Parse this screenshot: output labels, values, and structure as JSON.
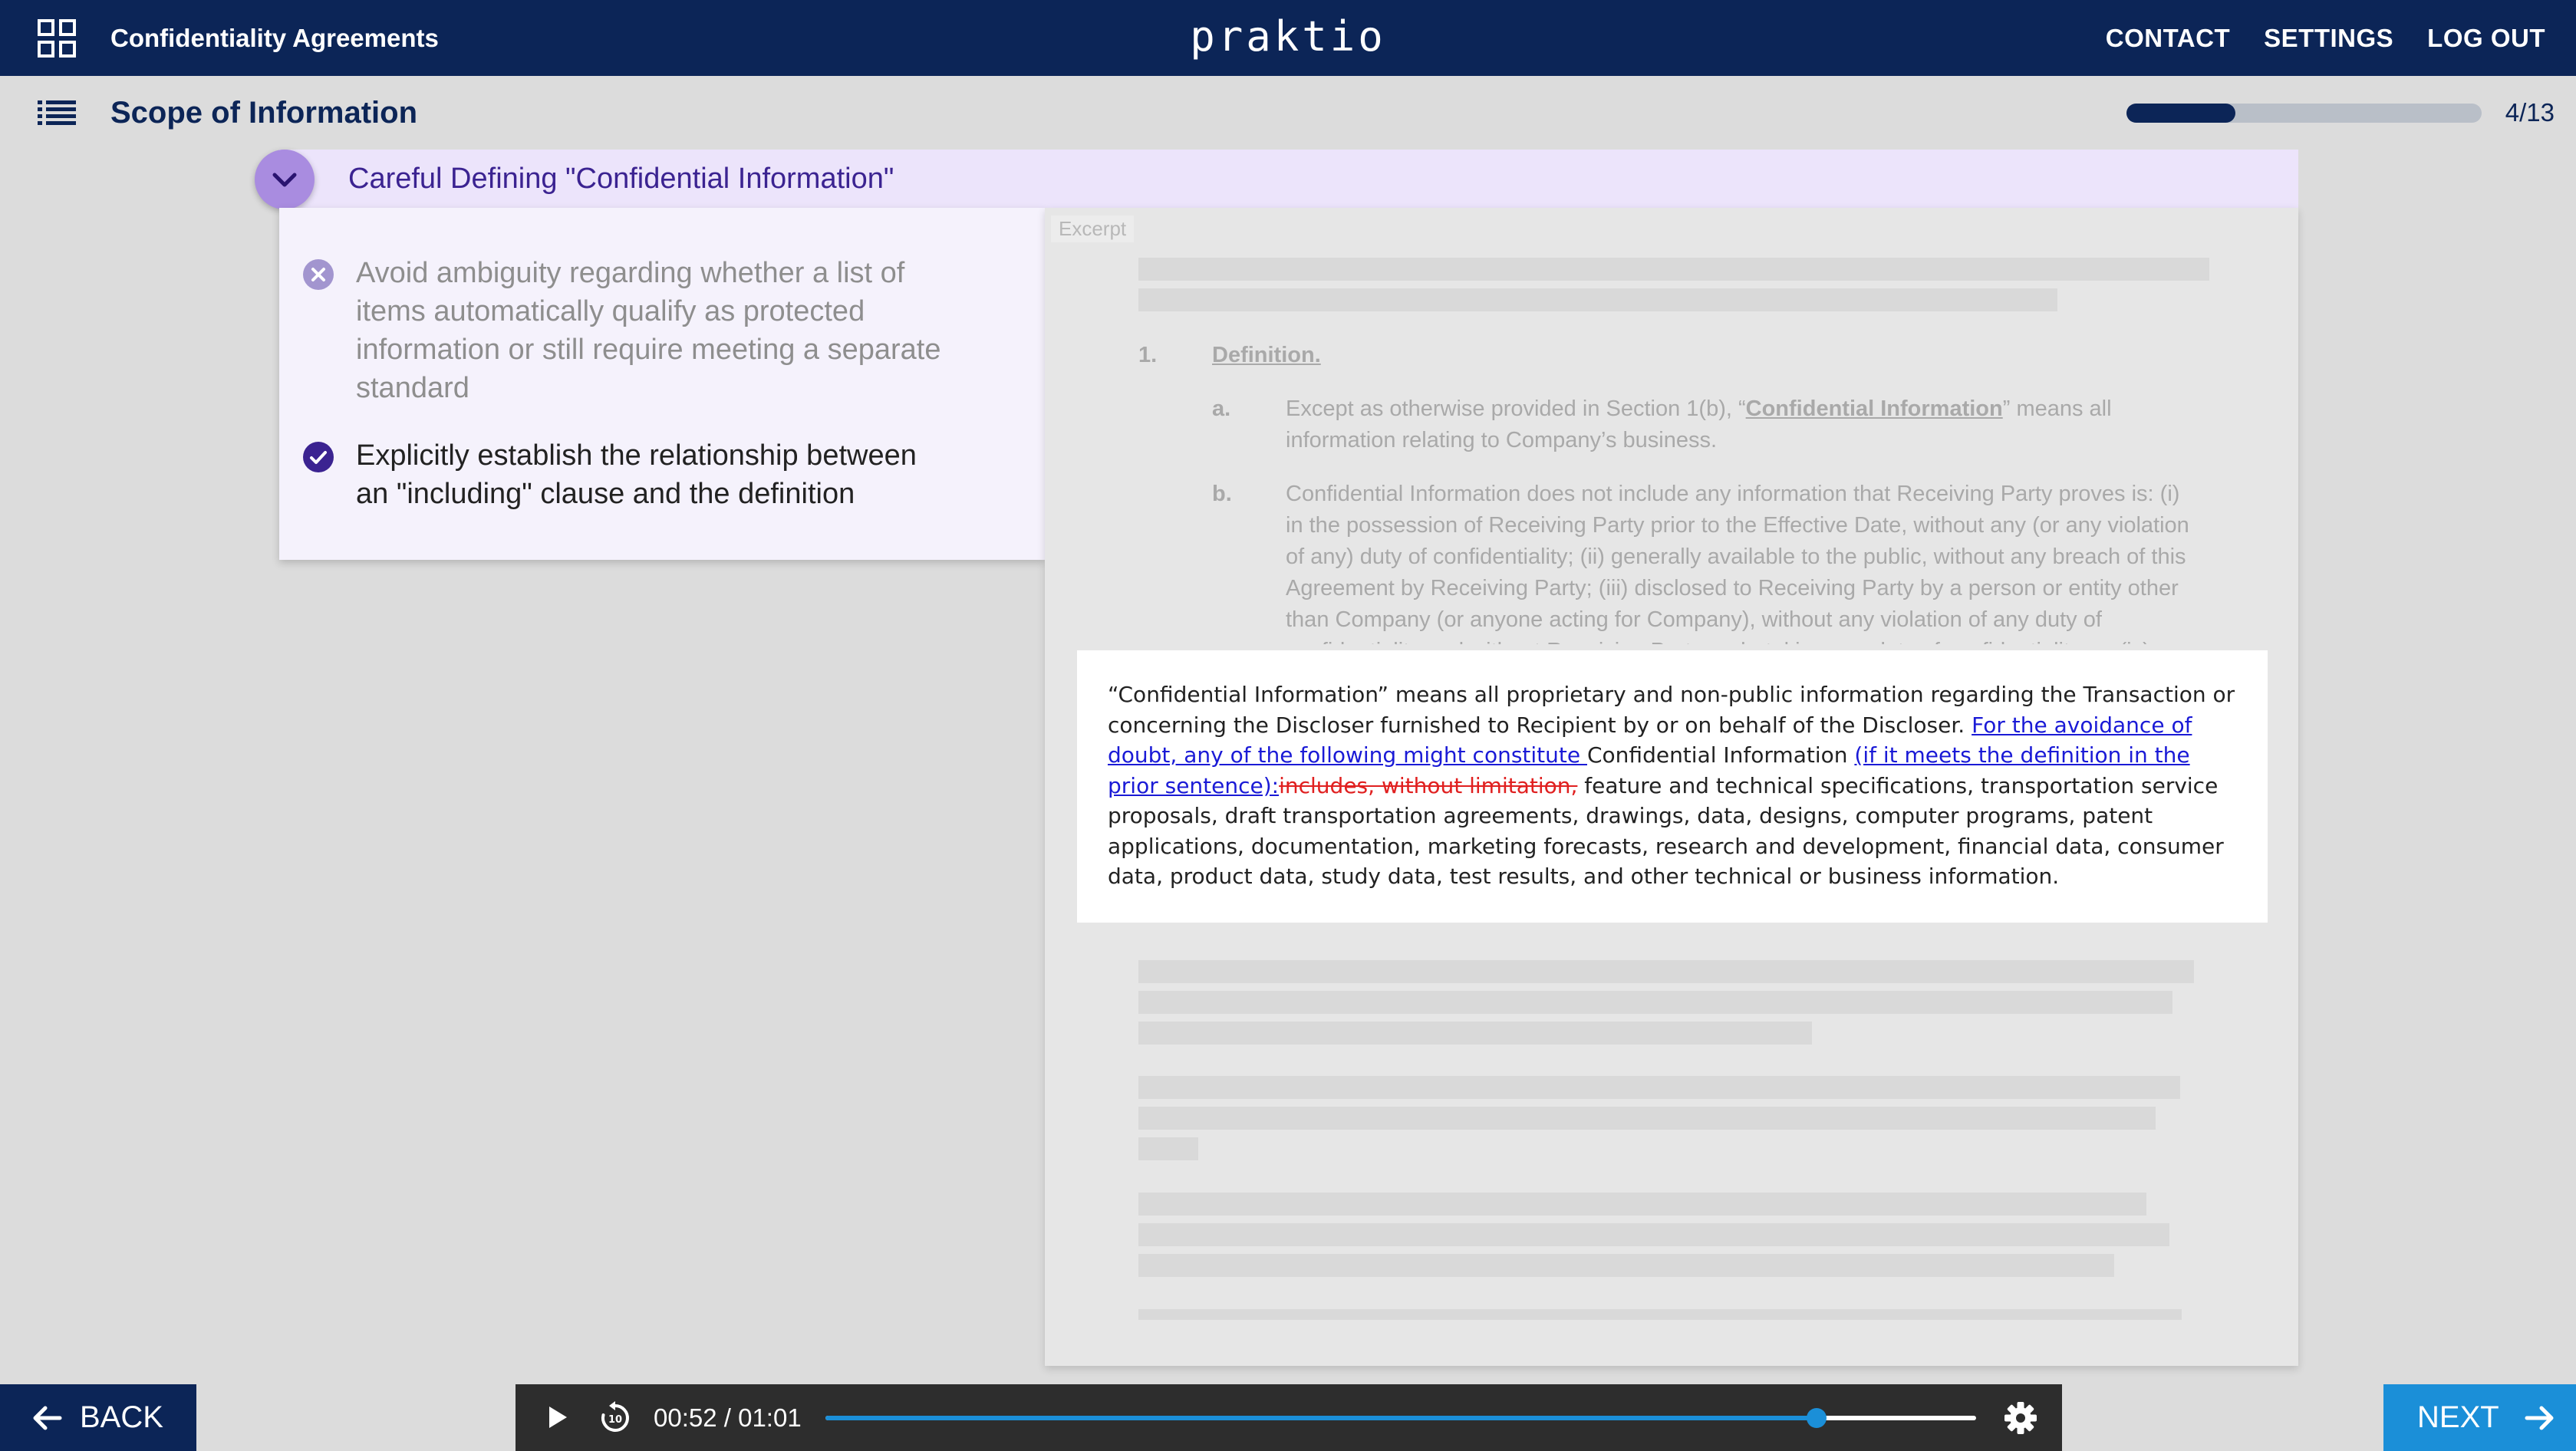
{
  "app": {
    "title": "Confidentiality Agreements",
    "logo": "praktio",
    "nav": [
      "CONTACT",
      "SETTINGS",
      "LOG OUT"
    ]
  },
  "section": {
    "title": "Scope of Information",
    "progress": {
      "current": 4,
      "total": 13,
      "label": "4/13"
    }
  },
  "card": {
    "title": "Careful Defining \"Confidential Information\"",
    "tips": [
      {
        "kind": "avoid",
        "text": "Avoid ambiguity regarding whether a list of items automatically qualify as protected information or still require meeting a separate standard"
      },
      {
        "kind": "do",
        "text": "Explicitly establish the relationship between an \"including\" clause and the definition"
      }
    ]
  },
  "document": {
    "excerpt_label": "Excerpt",
    "section_number": "1.",
    "section_heading": "Definition.",
    "items": [
      {
        "label": "a.",
        "text_before": "Except as otherwise provided in Section 1(b), “",
        "term": "Confidential Information",
        "text_after": "” means all information relating to Company’s business."
      },
      {
        "label": "b.",
        "text": "Confidential Information does not include any information that Receiving Party proves is: (i) in the possession of Receiving Party prior to the Effective Date, without any (or any violation of any) duty of confidentiality; (ii) generally available to the public, without any breach of this Agreement by Receiving Party; (iii) disclosed to Receiving Party by a person or entity other than Company (or anyone acting for Company), without any violation of any duty of confidentiality and without Receiving Party undertaking any duty of confidentiality; or (iv)"
      }
    ],
    "highlight": {
      "lead": "“Confidential Information” means all proprietary and non-public information regarding the Transaction or concerning the Discloser furnished to Recipient by or on behalf of the Discloser. ",
      "insert_1": "For the avoidance of doubt, any of the following might constitute ",
      "middle": "Confidential Information ",
      "insert_2": "(if it meets the definition in the prior sentence):",
      "deleted": "includes, without limitation,",
      "tail": " feature and technical specifications, transportation service proposals, draft transportation agreements, drawings, data, designs, computer programs, patent applications, documentation, marketing forecasts, research and development, financial data, consumer data, product data, study data, test results, and other technical or business information."
    }
  },
  "controls": {
    "back_label": "BACK",
    "next_label": "NEXT",
    "player": {
      "time": "00:52 / 01:01",
      "progress": 0.861
    }
  },
  "colors": {
    "header_bg": "#0c2557",
    "accent_purple": "#3b2391",
    "card_header_bg": "#ece4fb",
    "next_bg": "#1b8fd8",
    "insert_blue": "#1a1ad6",
    "delete_red": "#e02020"
  },
  "icons": {
    "app_menu": "grid-icon",
    "section_menu": "list-icon",
    "collapse": "chevron-down-icon",
    "avoid": "x-circle-icon",
    "do": "check-circle-icon",
    "play": "play-icon",
    "replay": "replay-10-icon",
    "settings": "gear-icon",
    "back": "arrow-left-icon",
    "next": "arrow-right-icon"
  }
}
